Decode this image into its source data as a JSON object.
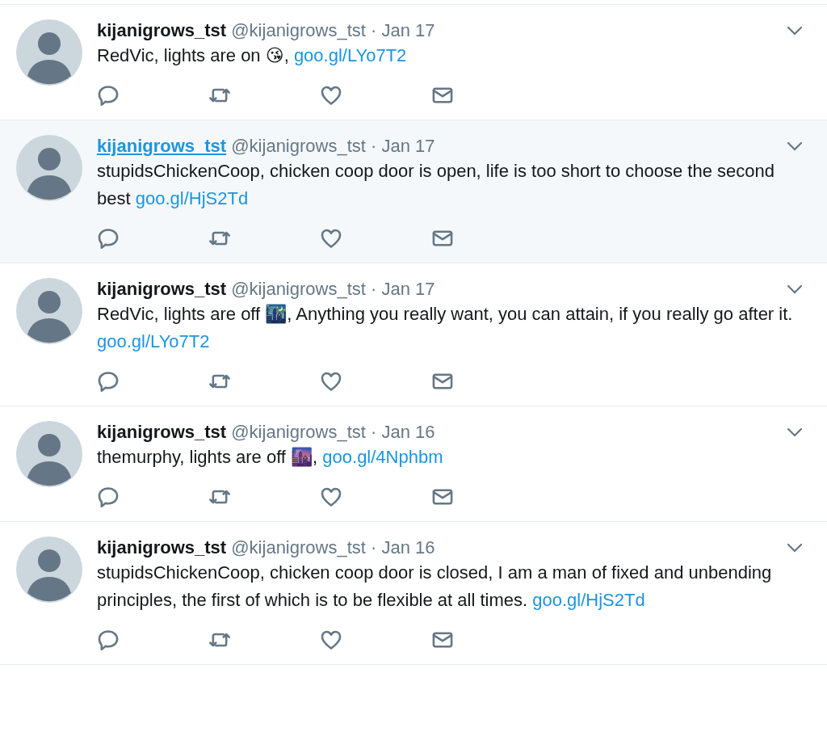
{
  "tweets": [
    {
      "name": "kijanigrows_tst",
      "handle": "@kijanigrows_tst",
      "sep": "·",
      "date": "Jan 17",
      "hovered": false,
      "text": "RedVic, lights are on 😘,  ",
      "link": "goo.gl/LYo7T2"
    },
    {
      "name": "kijanigrows_tst",
      "handle": "@kijanigrows_tst",
      "sep": "·",
      "date": "Jan 17",
      "hovered": true,
      "text": "stupidsChickenCoop, chicken coop door is open, life is too short to choose the second best ",
      "link": "goo.gl/HjS2Td"
    },
    {
      "name": "kijanigrows_tst",
      "handle": "@kijanigrows_tst",
      "sep": "·",
      "date": "Jan 17",
      "hovered": false,
      "text": "RedVic, lights are off 🌃, Anything you really want, you can attain, if you really go after it.   ",
      "link": "goo.gl/LYo7T2"
    },
    {
      "name": "kijanigrows_tst",
      "handle": "@kijanigrows_tst",
      "sep": "·",
      "date": "Jan 16",
      "hovered": false,
      "text": "themurphy, lights are off 🌆,  ",
      "link": "goo.gl/4Nphbm"
    },
    {
      "name": "kijanigrows_tst",
      "handle": "@kijanigrows_tst",
      "sep": "·",
      "date": "Jan 16",
      "hovered": false,
      "text": "stupidsChickenCoop, chicken coop door is closed, I am a man of fixed and unbending principles, the first of which is to be flexible at all times.  ",
      "link": "goo.gl/HjS2Td"
    }
  ]
}
